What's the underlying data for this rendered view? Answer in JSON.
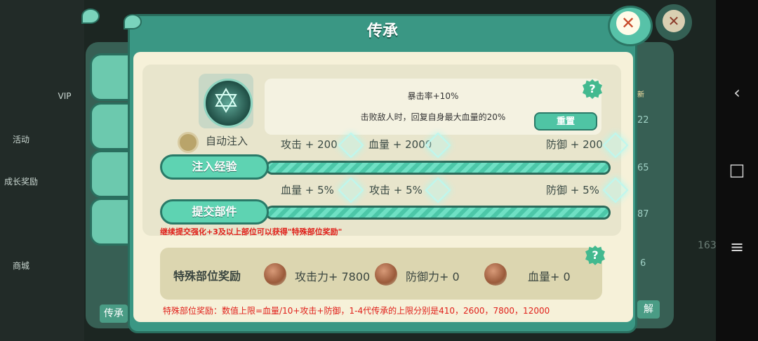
{
  "background": {
    "left_menu": [
      "VIP",
      "活动",
      "成长奖励",
      "商城"
    ],
    "right_badge": "新",
    "right_numbers": [
      "22",
      "65",
      "87",
      "6"
    ],
    "bottom_left_btn": "传承",
    "bottom_right_btn": "解",
    "side_count": "163"
  },
  "modal": {
    "title": "传承",
    "close_icon": "close-icon"
  },
  "talent": {
    "auto_inject_label": "自动注入",
    "effect_line1": "暴击率+10%",
    "effect_line2": "击败敌人时，回复自身最大血量的20%",
    "reset_label": "重置",
    "help_symbol": "?"
  },
  "exp_row": {
    "stats": [
      "攻击 + 200",
      "血量 + 2000",
      "防御 + 200"
    ],
    "button_label": "注入经验",
    "progress": 1.0
  },
  "parts_row": {
    "stats": [
      "血量 + 5%",
      "攻击 + 5%",
      "防御 + 5%"
    ],
    "button_label": "提交部件",
    "progress": 1.0
  },
  "tip_red": "继续提交强化+3及以上部位可以获得\"特殊部位奖励\"",
  "reward": {
    "title": "特殊部位奖励",
    "items": [
      "攻击力+ 7800",
      "防御力+ 0",
      "血量+ 0"
    ],
    "help_symbol": "?"
  },
  "note": "特殊部位奖励：数值上限=血量/10+攻击+防御，1-4代传承的上限分别是410，2600，7800，12000",
  "colors": {
    "modal_frame": "#3a9784",
    "panel_cream": "#f6f1d9",
    "accent_green": "#5ed3b2",
    "warning_red": "#e0201a"
  }
}
